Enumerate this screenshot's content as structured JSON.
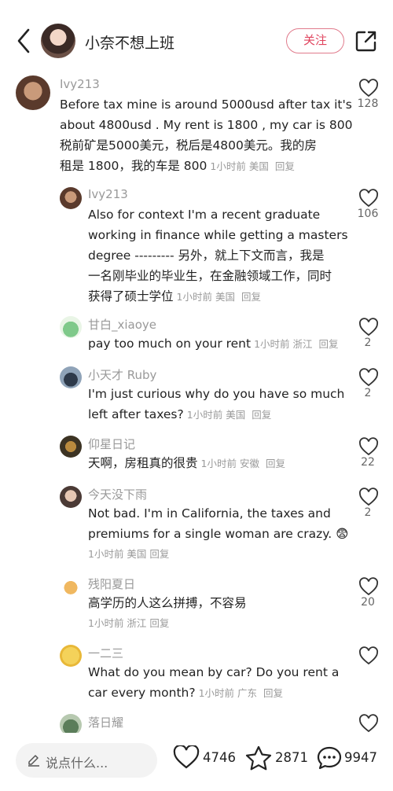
{
  "header": {
    "author_name": "小奈不想上班",
    "follow_label": "关注"
  },
  "comments": [
    {
      "user": "Ivy213",
      "lines": [
        "Before tax mine is around 5000usd after tax it's",
        "about 4800usd . My rent is 1800 , my car is 800",
        "税前矿是5000美元，税后是4800美元。我的房",
        "租是 1800，我的车是 800"
      ],
      "time": "1小时前",
      "location": "美国",
      "reply": "回复",
      "likes": "128"
    },
    {
      "user": "Ivy213",
      "lines": [
        "Also for context I'm a recent graduate",
        "working in finance while getting a masters",
        "degree --------- 另外，就上下文而言，我是",
        "一名刚毕业的毕业生，在金融领域工作，同时",
        "获得了硕士学位"
      ],
      "time": "1小时前",
      "location": "美国",
      "reply": "回复",
      "likes": "106"
    },
    {
      "user": "甘白_xiaoye",
      "lines": [
        "pay too much on your rent"
      ],
      "time": "1小时前",
      "location": "浙江",
      "reply": "回复",
      "likes": "2"
    },
    {
      "user": "小天才 Ruby",
      "lines": [
        "I'm just curious why do you have so much",
        "left after taxes?"
      ],
      "time": "1小时前",
      "location": "美国",
      "reply": "回复",
      "likes": "2"
    },
    {
      "user": "仰星日记",
      "lines": [
        "天啊，房租真的很贵"
      ],
      "time": "1小时前",
      "location": "安徽",
      "reply": "回复",
      "likes": "22"
    },
    {
      "user": "今天没下雨",
      "lines": [
        "Not bad. I'm in California, the taxes and",
        "premiums for a single woman are crazy. 😨"
      ],
      "meta_line": "1小时前 美国 回复",
      "likes": "2"
    },
    {
      "user": "残阳夏日",
      "lines": [
        "高学历的人这么拼搏，不容易"
      ],
      "meta_line": "1小时前 浙江 回复",
      "likes": "20"
    },
    {
      "user": "一二三",
      "lines": [
        "What do you mean by car?  Do you  rent a",
        "car every month?"
      ],
      "time": "1小时前",
      "location": "广东",
      "reply": "回复",
      "likes": ""
    },
    {
      "user": "落日耀",
      "lines": [],
      "likes": ""
    }
  ],
  "bottom": {
    "placeholder": "说点什么...",
    "likes": "4746",
    "favorites": "2871",
    "comments": "9947"
  },
  "icons": {
    "back": "chevron-left-icon",
    "share": "share-icon",
    "like": "heart-icon",
    "favorite": "star-icon",
    "comment": "comment-bubble-icon",
    "pencil": "pencil-icon"
  },
  "colors": {
    "follow_accent": "#e0445e",
    "meta_gray": "#9a9a9a"
  }
}
